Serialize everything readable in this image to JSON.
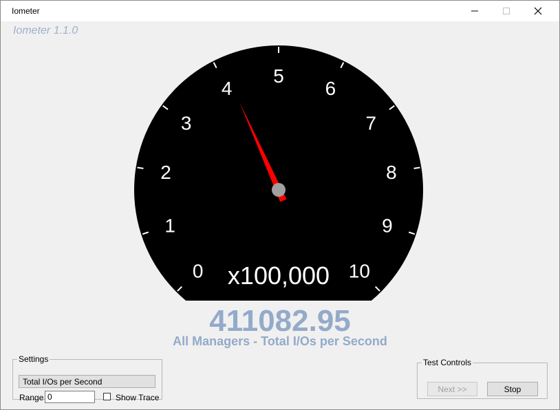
{
  "window": {
    "title": "Iometer",
    "controls": {
      "minimize_icon": "minimize-icon",
      "maximize_icon": "maximize-icon",
      "close_icon": "close-icon"
    }
  },
  "app_title": "Iometer 1.1.0",
  "gauge": {
    "scale_labels": [
      "0",
      "1",
      "2",
      "3",
      "4",
      "5",
      "6",
      "7",
      "8",
      "9",
      "10"
    ],
    "multiplier": "x100,000",
    "min": 0,
    "max": 10,
    "needle_value": 4.1108295,
    "colors": {
      "dial": "#000000",
      "needle": "#ff0000",
      "hub": "#a0a0a0",
      "text": "#ffffff"
    }
  },
  "readout": {
    "value": "411082.95",
    "label": "All Managers - Total I/Os per Second",
    "color": "#94aac9"
  },
  "settings": {
    "legend": "Settings",
    "metric_button": "Total I/Os per Second",
    "range_label": "Range",
    "range_value": "0",
    "show_trace_label": "Show Trace",
    "show_trace_checked": false
  },
  "test_controls": {
    "legend": "Test Controls",
    "next_button": "Next >>",
    "stop_button": "Stop"
  }
}
